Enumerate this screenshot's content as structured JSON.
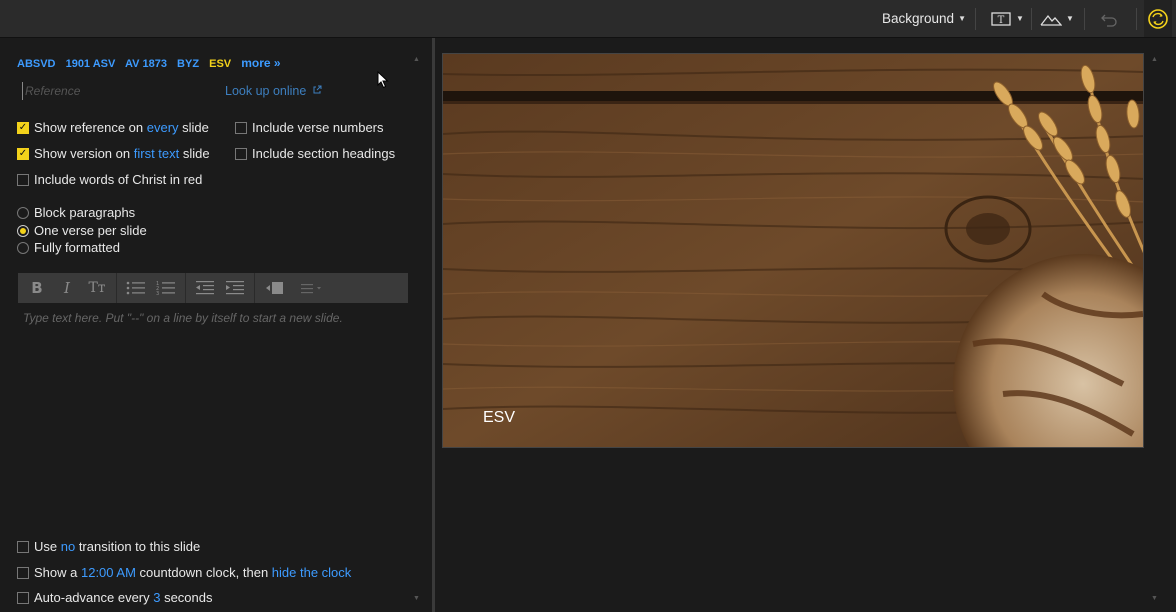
{
  "topbar": {
    "background_label": "Background"
  },
  "versions": [
    {
      "label": "ABSVD",
      "active": false
    },
    {
      "label": "1901 ASV",
      "active": false
    },
    {
      "label": "AV 1873",
      "active": false
    },
    {
      "label": "BYZ",
      "active": false
    },
    {
      "label": "ESV",
      "active": true
    },
    {
      "label": "more »",
      "active": false
    }
  ],
  "reference": {
    "placeholder": "Reference",
    "value": "",
    "lookup_label": "Look up online"
  },
  "options": {
    "show_reference": {
      "prefix": "Show reference on ",
      "link": "every",
      "suffix": " slide",
      "checked": true
    },
    "show_version": {
      "prefix": "Show version on ",
      "link": "first text",
      "suffix": " slide",
      "checked": true
    },
    "words_of_christ": {
      "label": "Include words of Christ in red",
      "checked": false
    },
    "verse_numbers": {
      "label": "Include verse numbers",
      "checked": false
    },
    "section_headings": {
      "label": "Include section headings",
      "checked": false
    }
  },
  "layout_options": [
    {
      "label": "Block paragraphs",
      "selected": false
    },
    {
      "label": "One verse per slide",
      "selected": true
    },
    {
      "label": "Fully formatted",
      "selected": false
    }
  ],
  "editor": {
    "placeholder": "Type text here. Put \"--\" on a line by itself to start a new slide."
  },
  "bottom_options": {
    "transition": {
      "prefix": "Use ",
      "link": "no",
      "suffix": " transition to this slide",
      "checked": false
    },
    "countdown": {
      "prefix": "Show a ",
      "link1": "12:00 AM",
      "middle": " countdown clock, then ",
      "link2": "hide the clock",
      "checked": false
    },
    "auto_advance": {
      "prefix": "Auto-advance every ",
      "link": "3",
      "suffix": " seconds",
      "checked": false
    }
  },
  "slide": {
    "version_label": "ESV"
  },
  "colors": {
    "accent": "#f3d21b",
    "link": "#3d9bff",
    "panel": "#1b1b1b"
  }
}
